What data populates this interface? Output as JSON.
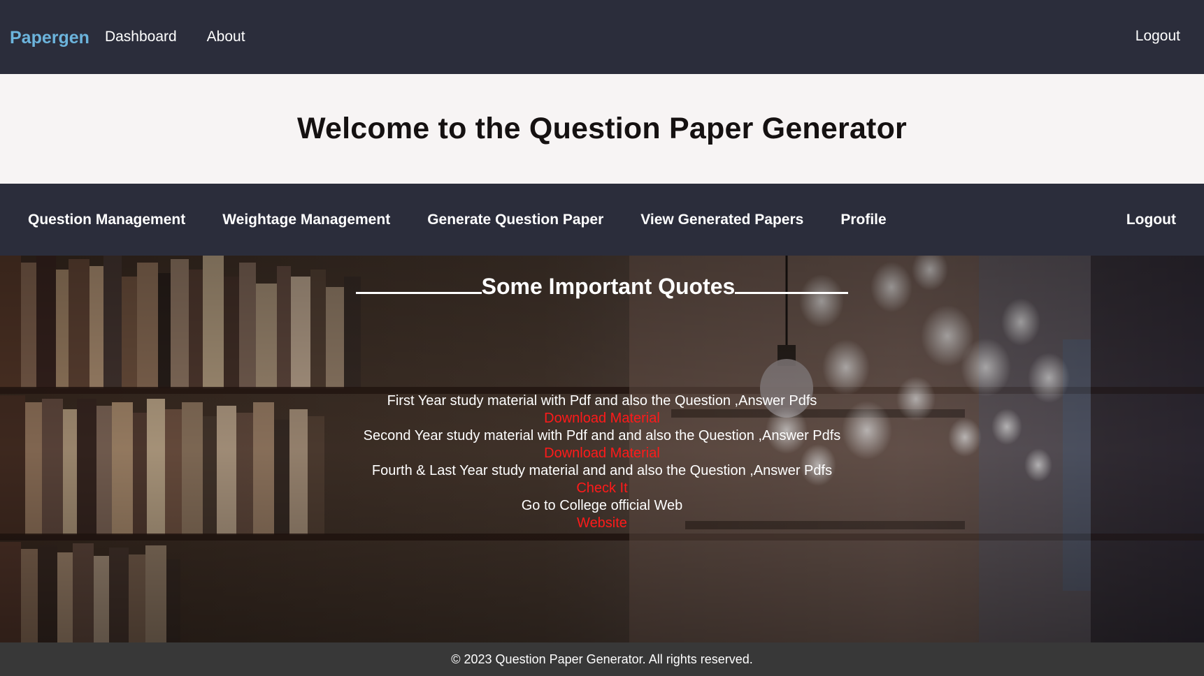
{
  "topbar": {
    "brand": "Papergen",
    "links": [
      "Dashboard",
      "About"
    ],
    "logout": "Logout"
  },
  "hero": {
    "title": "Welcome to the Question Paper Generator"
  },
  "subnav": {
    "links": [
      "Question Management",
      "Weightage Management",
      "Generate Question Paper",
      "View Generated Papers",
      "Profile"
    ],
    "logout": "Logout"
  },
  "library": {
    "title": "Some Important Quotes",
    "items": [
      {
        "text": "First Year study material with Pdf and also the Question ,Answer Pdfs",
        "link": "Download Material"
      },
      {
        "text": "Second Year study material with Pdf and and also the Question ,Answer Pdfs",
        "link": "Download Material"
      },
      {
        "text": "Fourth & Last Year study material and and also the Question ,Answer Pdfs",
        "link": "Check It"
      },
      {
        "text": "Go to College official Web",
        "link": "Website"
      }
    ]
  },
  "footer": {
    "text": "© 2023 Question Paper Generator. All rights reserved."
  },
  "colors": {
    "nav_bg": "#2b2d3b",
    "brand": "#6cb4dc",
    "hero_bg": "#f7f4f4",
    "link_red": "#ff1a1a",
    "footer_bg": "#383838"
  }
}
